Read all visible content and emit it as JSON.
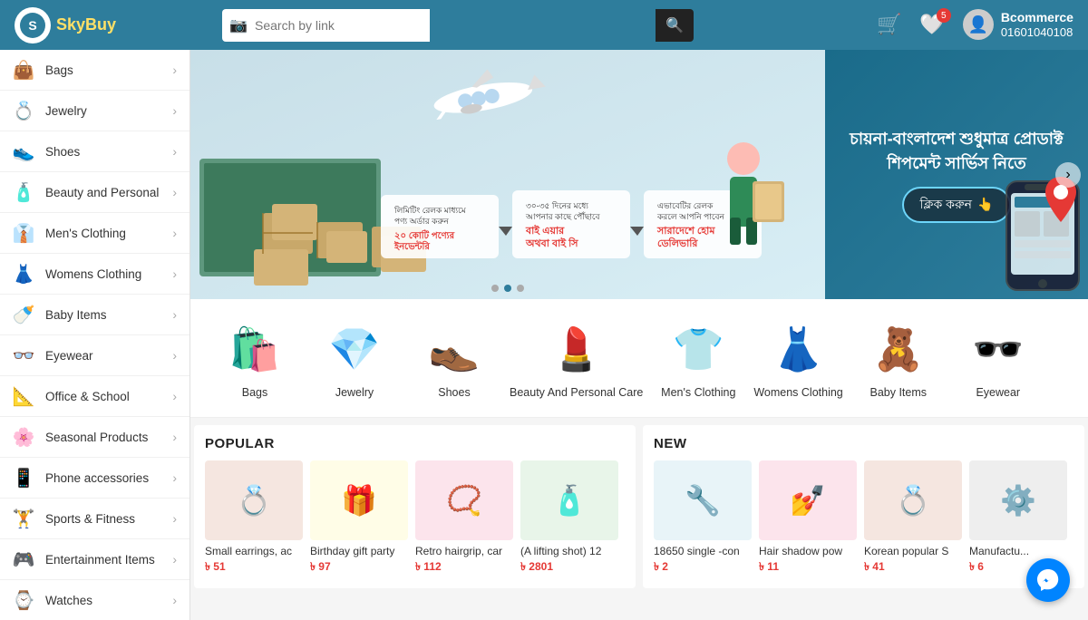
{
  "header": {
    "logo_text_1": "Sky",
    "logo_text_2": "Buy",
    "search_placeholder": "Search by link",
    "cart_count": "",
    "wishlist_count": "5",
    "user_name": "Bcommerce",
    "user_phone": "01601040108"
  },
  "sidebar": {
    "items": [
      {
        "id": "bags",
        "label": "Bags",
        "icon": "👜"
      },
      {
        "id": "jewelry",
        "label": "Jewelry",
        "icon": "💍"
      },
      {
        "id": "shoes",
        "label": "Shoes",
        "icon": "👟"
      },
      {
        "id": "beauty",
        "label": "Beauty and Personal",
        "icon": "🧴"
      },
      {
        "id": "mens",
        "label": "Men's Clothing",
        "icon": "👔"
      },
      {
        "id": "womens",
        "label": "Womens Clothing",
        "icon": "👗"
      },
      {
        "id": "baby",
        "label": "Baby Items",
        "icon": "🍼"
      },
      {
        "id": "eyewear",
        "label": "Eyewear",
        "icon": "👓"
      },
      {
        "id": "office",
        "label": "Office & School",
        "icon": "📐"
      },
      {
        "id": "seasonal",
        "label": "Seasonal Products",
        "icon": "🌸"
      },
      {
        "id": "phone",
        "label": "Phone accessories",
        "icon": "📱"
      },
      {
        "id": "sports",
        "label": "Sports & Fitness",
        "icon": "🏋️"
      },
      {
        "id": "entertainment",
        "label": "Entertainment Items",
        "icon": "🎮"
      },
      {
        "id": "watches",
        "label": "Watches",
        "icon": "⌚"
      }
    ]
  },
  "banner": {
    "right_text_line1": "চায়না-বাংলাদেশ শুধুমাত্র প্রোডাক্ট",
    "right_text_line2": "শিপমেন্ট সার্ভিস নিতে",
    "btn_label": "ক্লিক করুন",
    "dot_count": 3
  },
  "categories": [
    {
      "label": "Bags",
      "icon": "👜",
      "color": "#e57373"
    },
    {
      "label": "Jewelry",
      "icon": "💎",
      "color": "#f9a825"
    },
    {
      "label": "Shoes",
      "icon": "👞",
      "color": "#795548"
    },
    {
      "label": "Beauty And\nPersonal Care",
      "icon": "💄",
      "color": "#e91e8c"
    },
    {
      "label": "Men's Clothing",
      "icon": "👕",
      "color": "#1e88e5"
    },
    {
      "label": "Womens Clothing",
      "icon": "👗",
      "color": "#e91e63"
    },
    {
      "label": "Baby Items",
      "icon": "🧸",
      "color": "#42a5f5"
    },
    {
      "label": "Eyewear",
      "icon": "🕶️",
      "color": "#5e35b1"
    }
  ],
  "popular": {
    "title": "POPULAR",
    "products": [
      {
        "name": "Small earrings, ac",
        "price": "৳ 51",
        "icon": "💍"
      },
      {
        "name": "Birthday gift party",
        "price": "৳ 97",
        "icon": "🎁"
      },
      {
        "name": "Retro hairgrip, car",
        "price": "৳ 112",
        "icon": "📿"
      },
      {
        "name": "(A lifting shot)  12",
        "price": "৳ 2801",
        "icon": "🧴"
      }
    ]
  },
  "new_products": {
    "title": "NEW",
    "products": [
      {
        "name": "18650 single -con",
        "price": "৳ 2",
        "icon": "🔧"
      },
      {
        "name": "Hair shadow pow",
        "price": "৳ 11",
        "icon": "💅"
      },
      {
        "name": "Korean popular S",
        "price": "৳ 41",
        "icon": "💍"
      },
      {
        "name": "Manufactu...",
        "price": "৳ 6",
        "icon": "⚙️"
      }
    ]
  }
}
